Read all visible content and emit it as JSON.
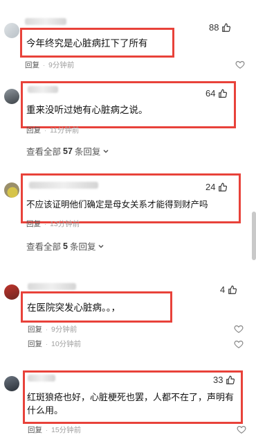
{
  "comments": [
    {
      "likes": "88",
      "text": "今年终究是心脏病扛下了所有",
      "reply_label": "回复",
      "time": "9分钟前"
    },
    {
      "likes": "64",
      "text": "重来没听过她有心脏病之说。",
      "reply_label": "回复",
      "time": "11分钟前",
      "view_all_prefix": "查看全部",
      "view_all_count": "57",
      "view_all_suffix": "条回复"
    },
    {
      "likes": "24",
      "text": "不应该证明他们确定是母女关系才能得到财产吗",
      "reply_label": "回复",
      "time": "13分钟前",
      "view_all_prefix": "查看全部",
      "view_all_count": "5",
      "view_all_suffix": "条回复"
    },
    {
      "likes": "4",
      "text": "在医院突发心脏病。。，",
      "reply_label": "回复",
      "time": "9分钟前",
      "reply_label_2": "回复",
      "time_2": "10分钟前"
    },
    {
      "likes": "33",
      "text_line1": "红斑狼疮也好，心脏梗死也罢，人都不在了，声明有",
      "text_line2": "什么用。",
      "reply_label": "回复",
      "time": "15分钟前"
    }
  ],
  "colors": {
    "highlight_box": "#e8423a",
    "meta_text": "#8a8a8a"
  },
  "icons": {
    "like": "thumbs-up-icon",
    "heart": "heart-outline-icon",
    "expand": "chevron-down-icon"
  }
}
